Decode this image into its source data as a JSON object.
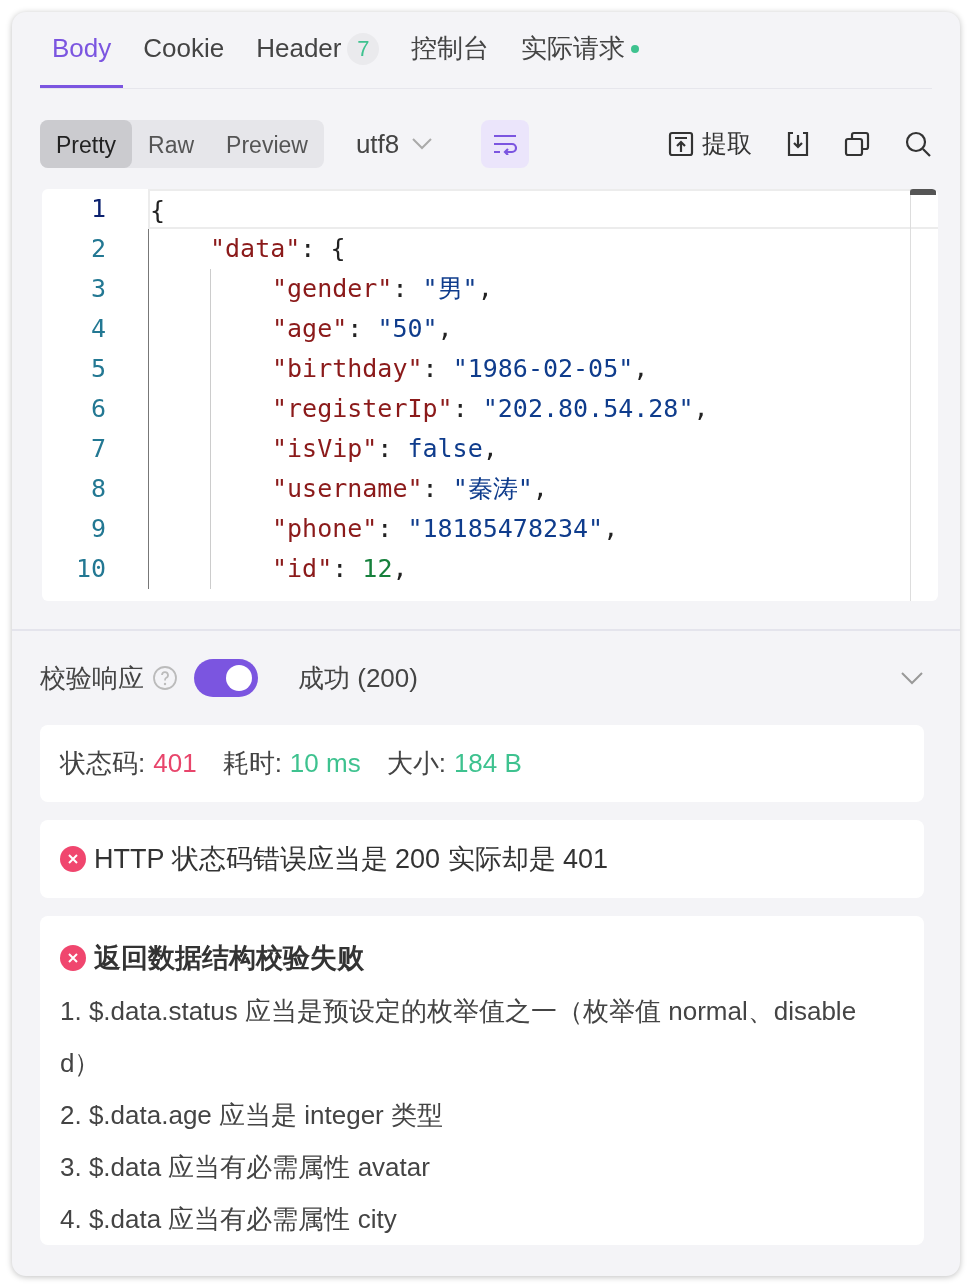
{
  "tabs": [
    {
      "label": "Body",
      "selected": true
    },
    {
      "label": "Cookie",
      "selected": false
    },
    {
      "label": "Header",
      "selected": false,
      "count": "7"
    },
    {
      "label": "控制台",
      "selected": false
    },
    {
      "label": "实际请求",
      "selected": false,
      "color": "#3ec28f"
    }
  ],
  "view_modes": [
    {
      "label": "Pretty",
      "selected": true
    },
    {
      "label": "Raw",
      "selected": false
    },
    {
      "label": "Preview",
      "selected": false
    }
  ],
  "encoding": "utf8",
  "wrap": {
    "on": true
  },
  "extract_label": "提取",
  "code_lines": [
    {
      "number": "1",
      "active": true,
      "tokens": [
        {
          "kind": "punct",
          "text": "{"
        }
      ],
      "children": [
        {
          "number": "2",
          "active": false,
          "tokens": [
            {
              "kind": "key",
              "text": "\"data\""
            },
            {
              "kind": "punct",
              "text": ": {"
            }
          ],
          "children": [
            {
              "number": "3",
              "active": false,
              "tokens": [
                {
                  "kind": "key",
                  "text": "\"gender\""
                },
                {
                  "kind": "punct",
                  "text": ": "
                },
                {
                  "kind": "string",
                  "text": "\"男\""
                },
                {
                  "kind": "punct",
                  "text": ","
                }
              ]
            },
            {
              "number": "4",
              "active": false,
              "tokens": [
                {
                  "kind": "key",
                  "text": "\"age\""
                },
                {
                  "kind": "punct",
                  "text": ": "
                },
                {
                  "kind": "string",
                  "text": "\"50\""
                },
                {
                  "kind": "punct",
                  "text": ","
                }
              ]
            },
            {
              "number": "5",
              "active": false,
              "tokens": [
                {
                  "kind": "key",
                  "text": "\"birthday\""
                },
                {
                  "kind": "punct",
                  "text": ": "
                },
                {
                  "kind": "string",
                  "text": "\"1986-02-05\""
                },
                {
                  "kind": "punct",
                  "text": ","
                }
              ]
            },
            {
              "number": "6",
              "active": false,
              "tokens": [
                {
                  "kind": "key",
                  "text": "\"registerIp\""
                },
                {
                  "kind": "punct",
                  "text": ": "
                },
                {
                  "kind": "string",
                  "text": "\"202.80.54.28\""
                },
                {
                  "kind": "punct",
                  "text": ","
                }
              ]
            },
            {
              "number": "7",
              "active": false,
              "tokens": [
                {
                  "kind": "key",
                  "text": "\"isVip\""
                },
                {
                  "kind": "punct",
                  "text": ": "
                },
                {
                  "kind": "bool",
                  "text": "false"
                },
                {
                  "kind": "punct",
                  "text": ","
                }
              ]
            },
            {
              "number": "8",
              "active": false,
              "tokens": [
                {
                  "kind": "key",
                  "text": "\"username\""
                },
                {
                  "kind": "punct",
                  "text": ": "
                },
                {
                  "kind": "string",
                  "text": "\"秦涛\""
                },
                {
                  "kind": "punct",
                  "text": ","
                }
              ]
            },
            {
              "number": "9",
              "active": false,
              "tokens": [
                {
                  "kind": "key",
                  "text": "\"phone\""
                },
                {
                  "kind": "punct",
                  "text": ": "
                },
                {
                  "kind": "string",
                  "text": "\"18185478234\""
                },
                {
                  "kind": "punct",
                  "text": ","
                }
              ]
            },
            {
              "number": "10",
              "active": false,
              "tokens": [
                {
                  "kind": "key",
                  "text": "\"id\""
                },
                {
                  "kind": "punct",
                  "text": ": "
                },
                {
                  "kind": "number",
                  "text": "12"
                },
                {
                  "kind": "punct",
                  "text": ","
                }
              ]
            }
          ]
        }
      ]
    }
  ],
  "validation": {
    "label": "校验响应",
    "enabled": true,
    "expected": "成功 (200)"
  },
  "stats": [
    {
      "label": "状态码:",
      "value": "401",
      "color": "#e8456b"
    },
    {
      "label": "耗时:",
      "value": "10 ms",
      "color": "#3ec28f"
    },
    {
      "label": "大小:",
      "value": "184 B",
      "color": "#3ec28f"
    }
  ],
  "errors": [
    {
      "title": "HTTP 状态码错误应当是 200 实际却是 401"
    },
    {
      "title": "返回数据结构校验失败",
      "items": [
        "1. $.data.status 应当是预设定的枚举值之一（枚举值 normal、disabled）",
        "2. $.data.age 应当是 integer 类型",
        "3. $.data 应当有必需属性 avatar",
        "4. $.data 应当有必需属性 city"
      ]
    }
  ]
}
